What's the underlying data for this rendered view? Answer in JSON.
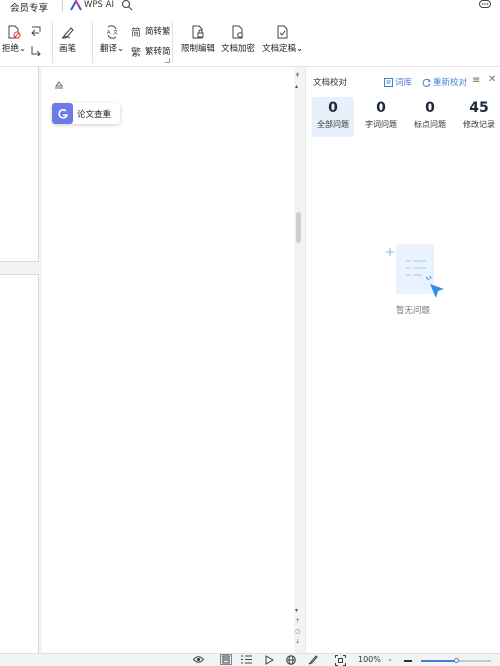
{
  "tabs": {
    "member": "会员专享",
    "wps_ai": "WPS AI"
  },
  "ribbon": {
    "reject_label": "拒绝",
    "pen_label": "画笔",
    "translate_label": "翻译",
    "to_traditional_label": "简转繁",
    "to_simplified_label": "繁转简",
    "restrict_edit_label": "限制编辑",
    "encrypt_label": "文档加密",
    "finalize_label": "文档定稿"
  },
  "doc": {
    "paper_check_label": "论文查重"
  },
  "panel": {
    "title": "文档校对",
    "ciku_label": "词库",
    "recheck_label": "重新校对",
    "stats": [
      {
        "value": "0",
        "label": "全部问题"
      },
      {
        "value": "0",
        "label": "字词问题"
      },
      {
        "value": "0",
        "label": "标点问题"
      },
      {
        "value": "45",
        "label": "修改记录"
      }
    ],
    "empty_label": "暂无问题"
  },
  "status": {
    "zoom_value": "100%",
    "zoom_fraction": 0.5
  },
  "colors": {
    "accent": "#4a7fd6",
    "paper_check_icon": "#6b7be6",
    "active_stat_bg": "#e8f1fb"
  }
}
